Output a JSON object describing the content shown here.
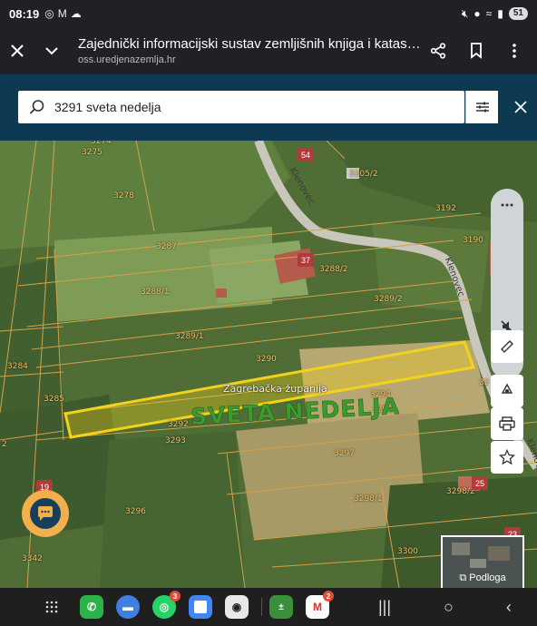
{
  "status": {
    "time": "08:19",
    "battery": "51",
    "left_icons": [
      "whatsapp-icon",
      "gmail-icon",
      "cloud-icon"
    ],
    "right_icons": [
      "mute-icon",
      "location-icon",
      "wifi-icon",
      "signal-icon"
    ]
  },
  "tab": {
    "title": "Zajednički informacijski sustav zemljišnih knjiga i katastra...",
    "url": "oss.uredjenazemlja.hr"
  },
  "search": {
    "value": "3291 sveta nedelja"
  },
  "map": {
    "municipality": "SVETA NEDELJA",
    "county": "Zagrebačka županija",
    "roads": [
      "Klenovec",
      "Klenovec",
      "Klenovec"
    ],
    "house_numbers": [
      "54",
      "37",
      "19",
      "25",
      "23"
    ],
    "parcels": [
      "3274",
      "3275",
      "3278",
      "3205/2",
      "3192",
      "3190",
      "3287",
      "3288/2",
      "3288/1",
      "3289/2",
      "3289/1",
      "3290",
      "3284",
      "3285",
      "3294",
      "3295",
      "3292",
      "3293",
      "3297",
      "3296",
      "3298/2",
      "3298/1",
      "3300",
      "3342",
      "32",
      "2"
    ],
    "selected_parcel_color": "#f2d21b"
  },
  "basemap": {
    "label": "Podloga"
  },
  "dock": {
    "apps": [
      {
        "name": "phone",
        "color": "#2bb34a",
        "badge": ""
      },
      {
        "name": "messages",
        "color": "#3f7fe0",
        "badge": ""
      },
      {
        "name": "whatsapp",
        "color": "#25d366",
        "badge": "3"
      },
      {
        "name": "calendar",
        "color": "#4285f4",
        "badge": ""
      },
      {
        "name": "camera",
        "color": "#e8e8e8",
        "badge": ""
      },
      {
        "name": "calculator",
        "color": "#3b8f3b",
        "badge": ""
      },
      {
        "name": "gmail",
        "color": "#ffffff",
        "badge": "2"
      }
    ]
  }
}
